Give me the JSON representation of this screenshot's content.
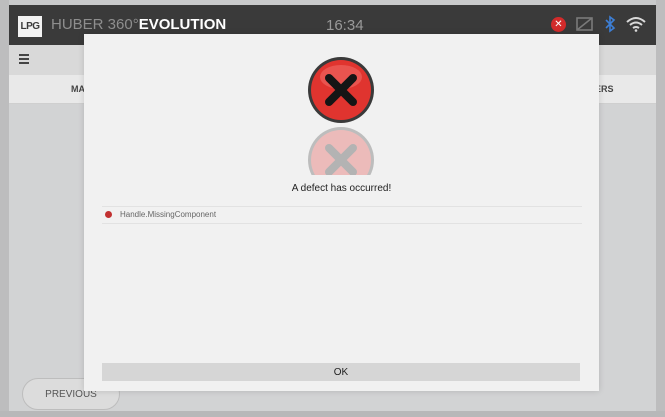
{
  "app": {
    "logo_text": "LPG",
    "brand_name": "HUBER 360°",
    "brand_suffix": "EVOLUTION",
    "time": "16:34"
  },
  "status_icons": [
    "error-icon",
    "no-signal-icon",
    "bluetooth-icon",
    "wifi-icon"
  ],
  "tabs": {
    "left_label": "MA",
    "right_label": "ERS"
  },
  "background": {
    "previous_label": "PREVIOUS"
  },
  "dialog": {
    "message": "A defect has occurred!",
    "defects": [
      {
        "text": "Handle.MissingComponent"
      }
    ],
    "ok_label": "OK"
  },
  "colors": {
    "topbar": "#3a3a3a",
    "error_red": "#e0342f",
    "dialog_bg": "#f1f1f1"
  }
}
